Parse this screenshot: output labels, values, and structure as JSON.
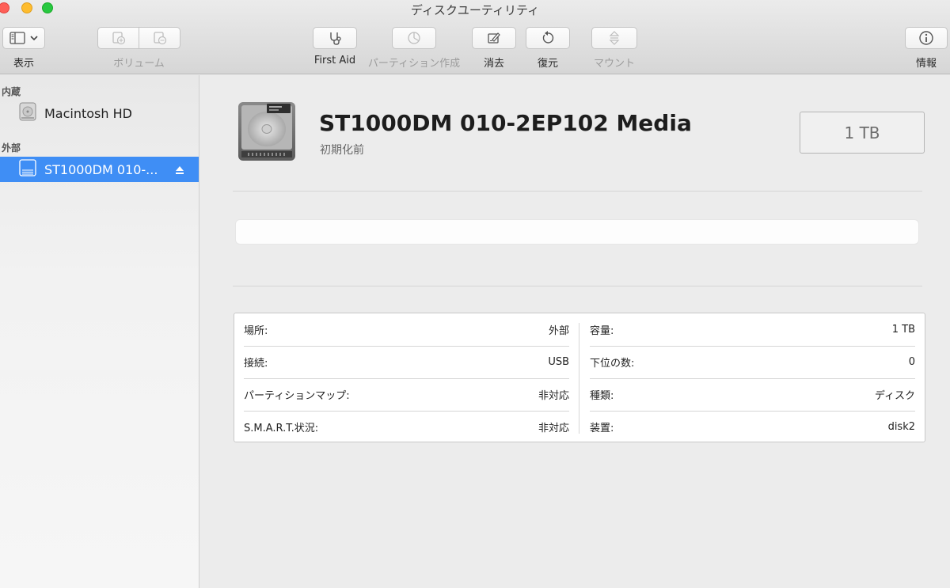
{
  "window": {
    "title": "ディスクユーティリティ"
  },
  "toolbar": {
    "view_label": "表示",
    "volume_label": "ボリューム",
    "first_aid_label": "First Aid",
    "partition_label": "パーティション作成",
    "erase_label": "消去",
    "restore_label": "復元",
    "mount_label": "マウント",
    "info_label": "情報",
    "icons": {
      "view": "sidebar-toggle-icon",
      "volume_add": "add-volume-icon",
      "volume_remove": "remove-volume-icon",
      "first_aid": "stethoscope-icon",
      "partition": "partition-icon",
      "erase": "erase-icon",
      "restore": "restore-icon",
      "mount": "mount-icon",
      "info": "info-icon"
    }
  },
  "sidebar": {
    "internal_header": "内蔵",
    "external_header": "外部",
    "internal_items": [
      {
        "label": "Macintosh HD",
        "icon": "internal-disk-icon"
      }
    ],
    "external_items": [
      {
        "label": "ST1000DM 010-...",
        "icon": "external-disk-icon",
        "selected": true
      }
    ]
  },
  "disk": {
    "name": "ST1000DM 010-2EP102 Media",
    "subtitle": "初期化前",
    "size": "1 TB"
  },
  "info": {
    "left": [
      {
        "label": "場所:",
        "value": "外部"
      },
      {
        "label": "接続:",
        "value": "USB"
      },
      {
        "label": "パーティションマップ:",
        "value": "非対応"
      },
      {
        "label": "S.M.A.R.T.状況:",
        "value": "非対応"
      }
    ],
    "right": [
      {
        "label": "容量:",
        "value": "1 TB"
      },
      {
        "label": "下位の数:",
        "value": "0"
      },
      {
        "label": "種類:",
        "value": "ディスク"
      },
      {
        "label": "装置:",
        "value": "disk2"
      }
    ]
  },
  "colors": {
    "selection": "#3f8ef5",
    "window_bg": "#ececec"
  }
}
